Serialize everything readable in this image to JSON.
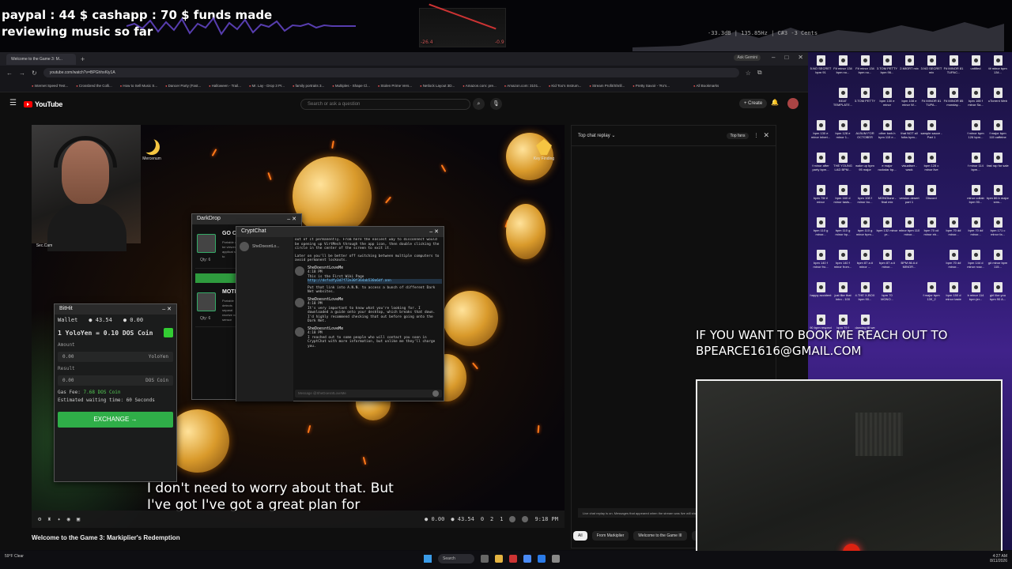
{
  "overlay": {
    "funds_line": "paypal : 44 $  cashapp : 70 $ funds made",
    "status_line": "reviewing music so far",
    "meter_left": "-26.4",
    "meter_right": "-0.9",
    "spectrum_readout": "-33.3dB | 135.85Hz | C#3 -3 Cents"
  },
  "browser": {
    "tab_title": "Welcome to the Game 3: M...",
    "ask_gemini": "Ask Gemini",
    "url": "youtube.com/watch?v=BPGhhxKiy1A",
    "bookmarks": [
      "Internet Speed Test...",
      "Crossbred the Colli...",
      "How to Sell Music S...",
      "Dancer Party (Fast...",
      "Halloween - Trail...",
      "Mr. Lay - Drop 3 Pr...",
      "family portraits 3...",
      "Multiples - Shape Cl...",
      "Stolen Prime Vers...",
      "Netlock Layout 3D...",
      "Amazon.com: pre...",
      "Amazon.com: 3101...",
      "Kid Too's Instrum...",
      "Stream Profit/Shrill...",
      "Pretty Savoir - 'Ro's..."
    ],
    "all_bookmarks": "All Bookmarks"
  },
  "youtube": {
    "logo": "YouTube",
    "search_placeholder": "Search or ask a question",
    "create": "Create",
    "video_title": "Welcome to the Game 3: Markiplier's Redemption"
  },
  "game": {
    "webcam_label": "Sec.Cam",
    "desktop_icons": [
      {
        "label": "Mercenum"
      },
      {
        "label": "Key Finding"
      }
    ],
    "bithit": {
      "title": "BitHit",
      "wallet_label": "Wallet",
      "wallet_yoloyen": "43.54",
      "wallet_dos": "0.00",
      "rate": "1 YoloYen = 0.10 DOS Coin",
      "amount_label": "Amount",
      "amount_value": "0.00",
      "amount_unit": "YoloYen",
      "result_label": "Result",
      "result_value": "0.00",
      "result_unit": "DOS Coin",
      "gas_fee_label": "Gas Fee:",
      "gas_fee_value": "7.68 DOS Coin",
      "wait_time": "Estimated waiting time: 60 Seconds",
      "exchange_button": "EXCHANGE →"
    },
    "darkdrop": {
      "title": "DarkDrop",
      "items": [
        {
          "name": "GO CA",
          "desc": "Portable can be viewed applicat sync to",
          "qty": "Qty: 6"
        },
        {
          "name": "MOTIO",
          "desc": "Portable detects separat receive notific sensor",
          "qty": "Qty: 6"
        }
      ],
      "progress": 0.45
    },
    "cryptchat": {
      "title": "CryptChat",
      "contact": "SheDoesntLo...",
      "intro": "out of it permanently. From here the easiest way to disconnect would be opening up VirtMesh through the app icon, then double clicking the circle in the center of the screen to exit it.",
      "intro2": "Later on you'll be better off switching between multiple computers to avoid permanent lockouts.",
      "messages": [
        {
          "sender": "SheDoesntLoveMe",
          "time": "4:18 PM",
          "text": "This is the First Wiki Page",
          "link": "http://dsfsdfy3d7f72e30f364ab530a6df.ann",
          "after": "Put that link into A.N.N. to access a bunch of different Dark Net websites."
        },
        {
          "sender": "SheDoesntLoveMe",
          "time": "4:18 PM",
          "text": "It's very important to know what you're looking for. I downloaded a guide onto your desktop, which breaks that down. I'd highly recommend checking that out before going onto the Dark Net.",
          "link": "",
          "after": ""
        },
        {
          "sender": "SheDoesntLoveMe",
          "time": "4:18 PM",
          "text": "I reached out to some people who will contact you soon in CryptChat with more information, but unlike me they'll charge you.",
          "link": "",
          "after": ""
        }
      ],
      "input_placeholder": "Message @SheDoesntLoveMe"
    },
    "subtitle": "I don't need to worry about that. But\nI've got I've got a great plan for",
    "taskbar": {
      "dos_balance": "0.00",
      "yolo_balance": "43.54",
      "stat1": "0",
      "stat2": "2",
      "stat3": "1",
      "time": "9:18 PM"
    }
  },
  "chat": {
    "header": "Top chat replay",
    "top_fans": "Top fans",
    "note": "Live chat replay is on. Messages that appeared when the stream was live will show up here.",
    "chips": [
      "All",
      "From Markiplier",
      "Welcome to the Game III",
      "Mark..."
    ]
  },
  "desktop": {
    "icons": [
      "5.NO SECRET bpm 91",
      "F# minor 134 bpm no...",
      "F# minor 134 bpm no...",
      "3.TOM PETTY bpm 96...",
      "2.MIGRT mix",
      "3.NO SECRET mix",
      "F# MINOR 81 TUPAC...",
      "untitled",
      "f# minor bpm 134...",
      "",
      "BEAT TEMPLATE...",
      "3.TOM PETTY",
      "bpm 130 e minor",
      "bpm 108 e minor W...",
      "F# MINOR 81 TUPA...",
      "F# MINOR 85 monday...",
      "bpm 165 f minor Sa...",
      "uTorrent Web",
      "bpm 130 e minor inheri...",
      "bpm 128 e minor 1...",
      "ALBUM FOR OCTOBER",
      "other bwh.h bpm 115 e...",
      "that NOT all folks bpm...",
      "sample sauce - Part 1",
      "",
      "f minor bpm 126 bpm...",
      "f major bpm 115 caffeine",
      "f minor after party bpm...",
      "THE YOUNG LAD BPM...",
      "wake up bpm 95 major",
      "e major rockstar bp...",
      "visualiser - wack",
      "bpm 128 c minor live",
      "",
      "f minor 114 bpm...",
      "fast rap for sale",
      "bpm 75f # minor",
      "bpm 160 d minor tasts...",
      "bpm 108 f minor bo...",
      "MONOtone - final mix",
      "version desert part 1",
      "Discord",
      "",
      "minor collab bpm 90...",
      "bpm 86 b major sms...",
      "bpm 110 g minor...",
      "bpm 110 g minor bp...",
      "bpm 110 g minor bpm...",
      "bpm 132 minor pr...",
      "minor bpm 110 minor...",
      "bpm 70 c# minor eb...",
      "bpm 70 d# minor...",
      "bpm 70 d# minor...",
      "bpm 171 c minor fa...",
      "bpm 140 f minor fro...",
      "bpm 140 f minor from...",
      "bpm 87 a # minor ...",
      "bpm 87 a # minor...",
      "BPM 86 A # MINOR...",
      "",
      "bpm 70 d# minor...",
      "bpm 144 d minor now...",
      "g# minor bpm 115...",
      "happy accident",
      "just like that intro - 100",
      "4.THE X-BOX bpm 90...",
      "bpm 70 MONO...",
      "",
      "f major bpm 139_2",
      "bpm 150 d minor taste",
      "b minor 114 bpm jer...",
      "girl like you bpm 90 A...",
      "90 bpm respect a...",
      "bpm 79 f minor...",
      "dancing till we are dea..."
    ]
  },
  "stream": {
    "booking_line1": "IF YOU WANT TO BOOK ME REACH OUT TO",
    "booking_line2": "BPEARCE1616@GMAIL.COM"
  },
  "wintaskbar": {
    "weather": "59°F Clear",
    "search": "Search",
    "time": "4:27 AM",
    "date": "8/11/2026"
  }
}
